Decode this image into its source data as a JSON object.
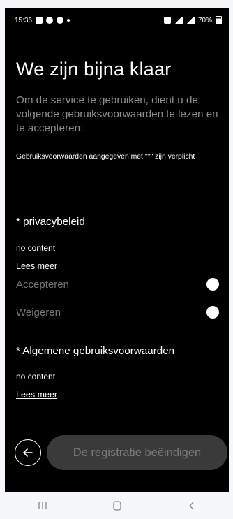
{
  "status_bar": {
    "time": "15:36",
    "battery": "70%",
    "icons": [
      "gallery-icon",
      "settings-icon",
      "cloud-icon",
      "dot-icon",
      "alarm-icon",
      "wifi-icon",
      "signal-icon",
      "battery-icon"
    ]
  },
  "header": {
    "title": "We zijn bijna klaar"
  },
  "intro": {
    "text": "Om de service te gebruiken, dient u de volgende gebruiksvoorwaarden te lezen en te accepteren:",
    "required_note": "Gebruiksvoorwaarden aangegeven met \"*\" zijn verplicht"
  },
  "privacy": {
    "title": "* privacybeleid",
    "content": "no content",
    "read_more": "Lees meer",
    "accept_label": "Accepteren",
    "decline_label": "Weigeren"
  },
  "terms": {
    "title": "* Algemene gebruiksvoorwaarden",
    "content": "no content",
    "read_more": "Lees meer"
  },
  "footer": {
    "back_icon": "arrow-left-icon",
    "finish_label": "De registratie beëindigen"
  },
  "nav_bar": {
    "icons": [
      "recent-apps-icon",
      "home-icon",
      "back-icon"
    ]
  },
  "colors": {
    "background": "#000000",
    "text": "#ffffff",
    "muted_text": "#8e8e8e",
    "disabled_button": "#3a3a3a",
    "nav_bar": "#f5f7fb"
  }
}
